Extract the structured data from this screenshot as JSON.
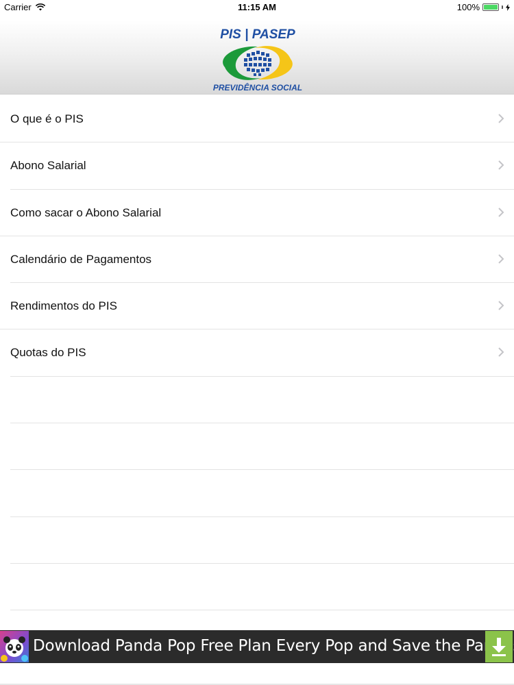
{
  "status_bar": {
    "carrier": "Carrier",
    "time": "11:15 AM",
    "battery": "100%",
    "battery_level": 1.0
  },
  "header": {
    "logo_top_text": "PIS | PASEP",
    "logo_bottom_text": "PREVIDÊNCIA SOCIAL",
    "colors": {
      "blue": "#1f4fa3",
      "green": "#1c9a3a",
      "yellow": "#f5c518"
    }
  },
  "menu": {
    "items": [
      {
        "label": "O que é o PIS"
      },
      {
        "label": "Abono Salarial"
      },
      {
        "label": "Como sacar o Abono Salarial"
      },
      {
        "label": "Calendário de Pagamentos"
      },
      {
        "label": "Rendimentos do PIS"
      },
      {
        "label": "Quotas do PIS"
      }
    ]
  },
  "ad": {
    "text": "Download Panda Pop Free Plan Every Pop and Save the Pandas",
    "icon": "download-icon",
    "accent": "#8bc34a"
  }
}
